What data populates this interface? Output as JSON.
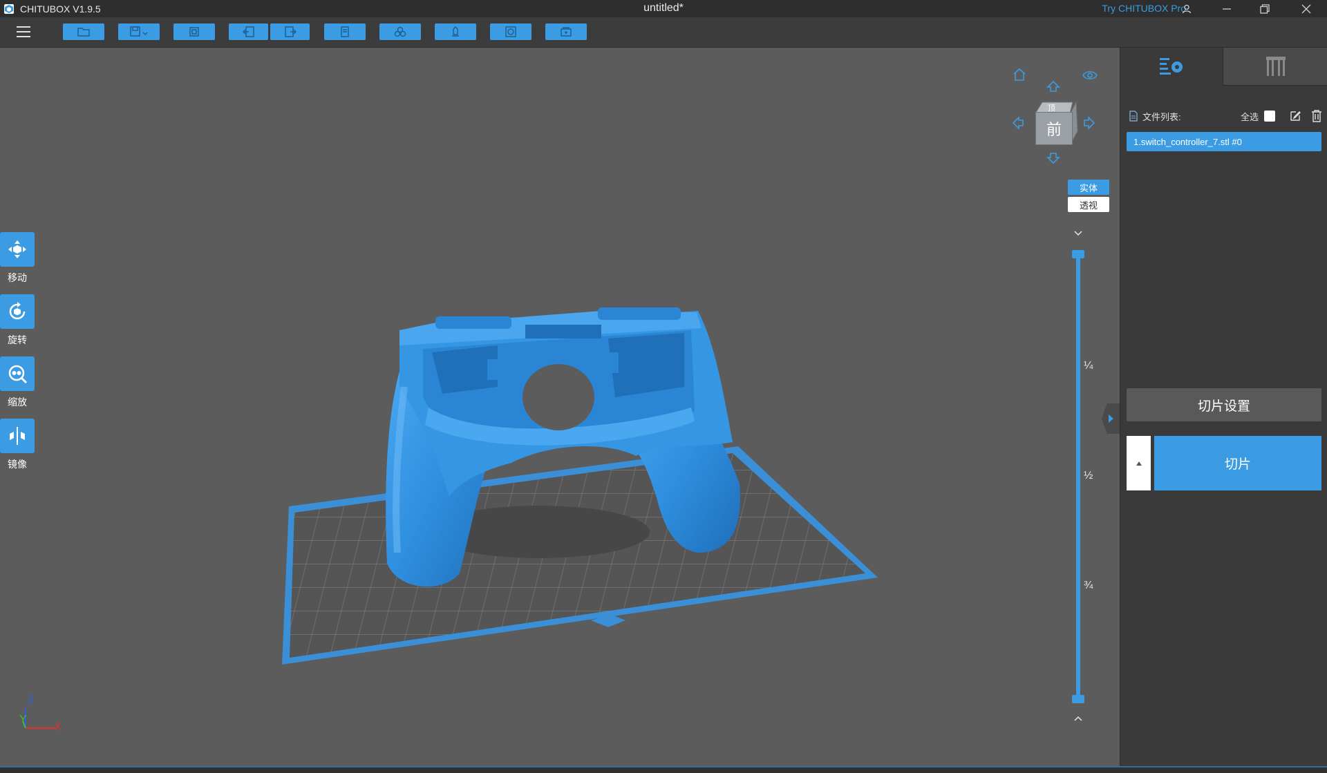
{
  "titlebar": {
    "app_name": "CHITUBOX V1.9.5",
    "document_title": "untitled*",
    "try_pro": "Try CHITUBOX Pro"
  },
  "toolbar": {
    "buttons": [
      "open-file",
      "save",
      "auto-layout",
      "undo",
      "redo",
      "copy",
      "hollow",
      "support",
      "dig-hole",
      "add-platform"
    ]
  },
  "left_tools": [
    {
      "label": "移动",
      "icon": "move-icon"
    },
    {
      "label": "旋转",
      "icon": "rotate-icon"
    },
    {
      "label": "缩放",
      "icon": "scale-icon"
    },
    {
      "label": "镜像",
      "icon": "mirror-icon"
    }
  ],
  "view_cube": {
    "face": "前",
    "top_face": "顶",
    "modes": {
      "solid": "实体",
      "perspective": "透视"
    }
  },
  "layer_slider": {
    "marks": [
      "¼",
      "½",
      "¾"
    ]
  },
  "axis": {
    "z": "Z",
    "y": "Y",
    "x": "X"
  },
  "right_panel": {
    "file_list_label": "文件列表:",
    "select_all_label": "全选",
    "files": [
      "1.switch_controller_7.stl #0"
    ],
    "slice_settings_label": "切片设置",
    "slice_label": "切片"
  },
  "colors": {
    "accent": "#3b9ce3",
    "model": "#2f8fe0",
    "viewport": "#5c5c5c",
    "panel": "#3a3a3a"
  }
}
